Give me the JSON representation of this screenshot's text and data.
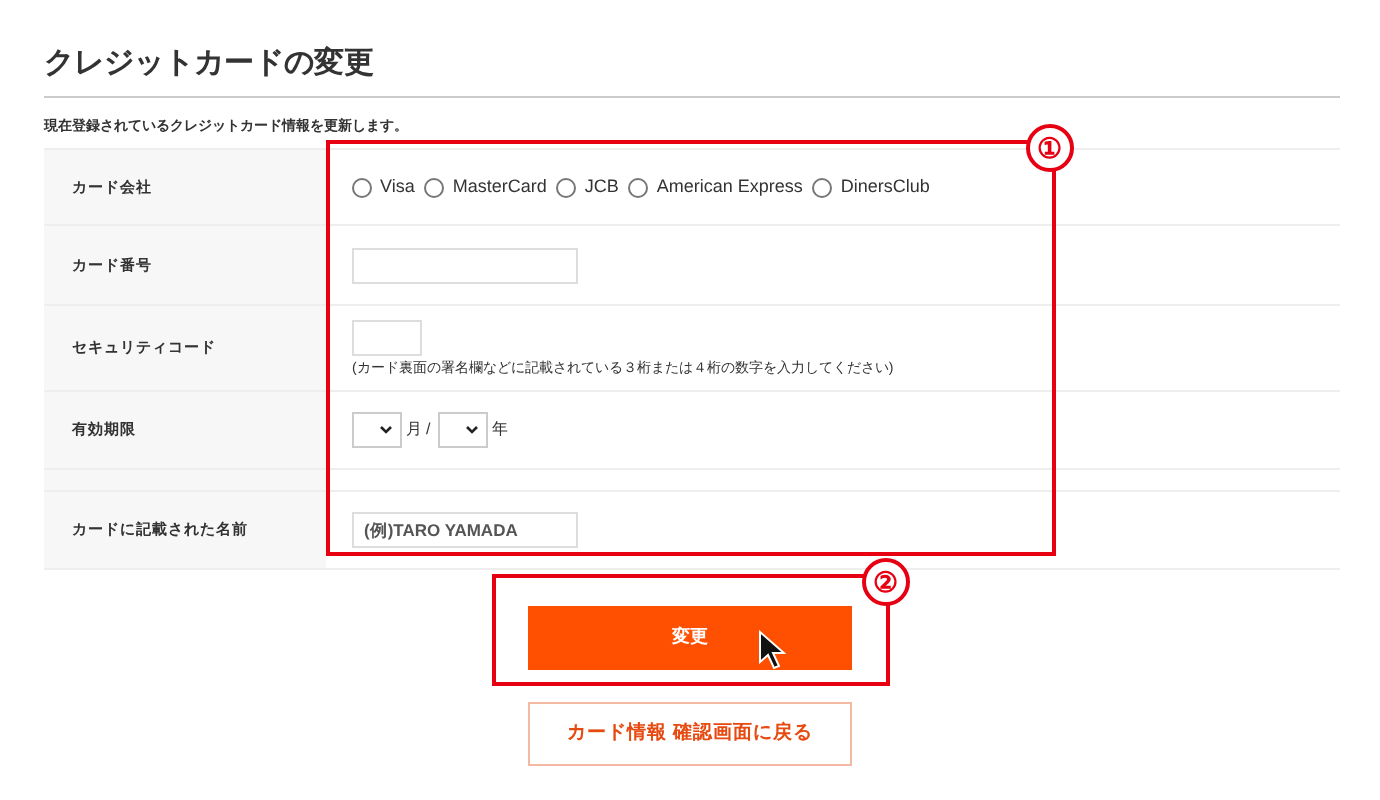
{
  "title": "クレジットカードの変更",
  "description": "現在登録されているクレジットカード情報を更新します。",
  "rows": [
    {
      "label": "カード会社",
      "kind": "radios",
      "options": [
        {
          "label": "Visa",
          "selected": false
        },
        {
          "label": "MasterCard",
          "selected": false
        },
        {
          "label": "JCB",
          "selected": false
        },
        {
          "label": "American Express",
          "selected": false
        },
        {
          "label": "DinersClub",
          "selected": false
        }
      ]
    },
    {
      "label": "カード番号",
      "kind": "text"
    },
    {
      "label": "セキュリティコード",
      "kind": "code",
      "note": "(カード裏面の署名欄などに記載されている３桁または４桁の数字を入力してください)"
    },
    {
      "label": "有効期限",
      "kind": "expiry",
      "month_unit": "月",
      "separator": "/",
      "year_unit": "年"
    },
    {
      "kind": "spacer"
    },
    {
      "label": "カードに記載された名前",
      "kind": "name",
      "placeholder": "(例)TARO YAMADA"
    }
  ],
  "submit_button": "変更",
  "back_button": "カード情報 確認画面に戻る",
  "annotations": [
    "①",
    "②"
  ]
}
